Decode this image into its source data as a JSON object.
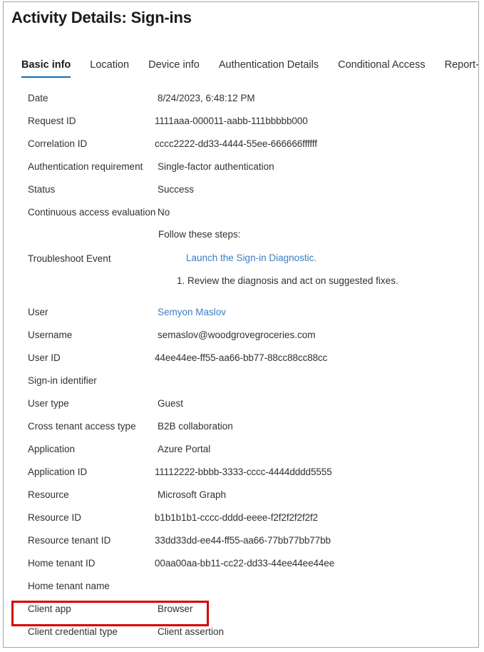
{
  "window": {
    "title": "Activity Details: Sign-ins",
    "border_color": "#a6a6a6"
  },
  "tabs": [
    {
      "label": "Basic info",
      "active": true
    },
    {
      "label": "Location",
      "active": false
    },
    {
      "label": "Device info",
      "active": false
    },
    {
      "label": "Authentication Details",
      "active": false
    },
    {
      "label": "Conditional Access",
      "active": false
    },
    {
      "label": "Report-only",
      "active": false
    }
  ],
  "accent": {
    "tab_underline": "#0f6cbd",
    "link": "#3b7cc4",
    "highlight": "#d40000"
  },
  "rows_top": [
    {
      "label": "Date",
      "value": "8/24/2023, 6:48:12 PM"
    },
    {
      "label": "Request ID",
      "value": "1111aaa-000011-aabb-111bbbbb000"
    },
    {
      "label": "Correlation ID",
      "value": "cccc2222-dd33-4444-55ee-666666ffffff"
    },
    {
      "label": "Authentication requirement",
      "value": "Single-factor authentication"
    },
    {
      "label": "Status",
      "value": "Success"
    },
    {
      "label": "Continuous access evaluation",
      "value": "No"
    }
  ],
  "troubleshoot": {
    "label": "Troubleshoot Event",
    "lead": "Follow these steps:",
    "link": "Launch the Sign-in Diagnostic.",
    "step": "1. Review the diagnosis and act on suggested fixes."
  },
  "rows_bottom": [
    {
      "label": "User",
      "value": "Semyon Maslov"
    },
    {
      "label": "Username",
      "value": "semaslov@woodgrovegroceries.com"
    },
    {
      "label": "User ID",
      "value": "44ee44ee-ff55-aa66-bb77-88cc88cc88cc"
    },
    {
      "label": "Sign-in identifier",
      "value": ""
    },
    {
      "label": "User type",
      "value": "Guest"
    },
    {
      "label": "Cross tenant access type",
      "value": "B2B collaboration"
    },
    {
      "label": "Application",
      "value": "Azure Portal"
    },
    {
      "label": "Application ID",
      "value": "11112222-bbbb-3333-cccc-4444dddd5555"
    },
    {
      "label": "Resource",
      "value": "Microsoft Graph"
    },
    {
      "label": "Resource ID",
      "value": "b1b1b1b1-cccc-dddd-eeee-f2f2f2f2f2f2"
    },
    {
      "label": "Resource tenant ID",
      "value": "33dd33dd-ee44-ff55-aa66-77bb77bb77bb"
    },
    {
      "label": "Home tenant ID",
      "value": "00aa00aa-bb11-cc22-dd33-44ee44ee44ee"
    },
    {
      "label": "Home tenant name",
      "value": ""
    },
    {
      "label": "Client app",
      "value": "Browser"
    },
    {
      "label": "Client credential type",
      "value": "Client assertion"
    }
  ],
  "highlighted_row_label": "Client app"
}
